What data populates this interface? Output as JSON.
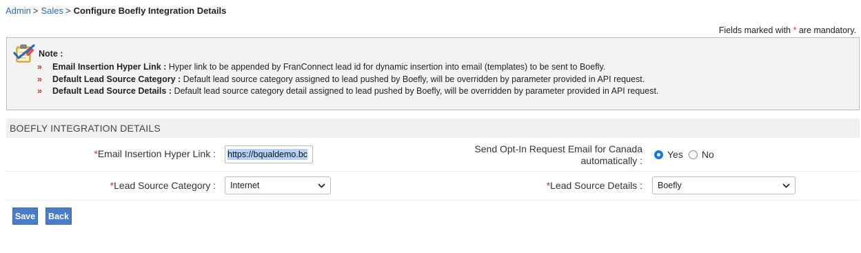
{
  "breadcrumb": {
    "items": [
      "Admin",
      "Sales"
    ],
    "separator": ">",
    "current": "Configure Boefly Integration Details"
  },
  "mandatory_note": {
    "prefix": "Fields marked with",
    "star": "*",
    "suffix": "are mandatory."
  },
  "note": {
    "title": "Note :",
    "bullet": "»",
    "items": [
      {
        "label": "Email Insertion Hyper Link :",
        "text": " Hyper link to be appended by FranConnect lead id for dynamic insertion into email (templates) to be sent to Boefly."
      },
      {
        "label": "Default Lead Source Category :",
        "text": " Default lead source category assigned to lead pushed by Boefly, will be overridden by parameter provided in API request."
      },
      {
        "label": "Default Lead Source Details :",
        "text": " Default lead source category detail assigned to lead pushed by Boefly, will be overridden by parameter provided in API request."
      }
    ]
  },
  "section": {
    "title": "BOEFLY INTEGRATION DETAILS"
  },
  "form": {
    "email_link": {
      "label": "Email Insertion Hyper Link :",
      "value": "https://bqualdemo.bc"
    },
    "opt_in": {
      "label_line1": "Send Opt-In Request Email for Canada",
      "label_line2": "automatically :",
      "options": [
        "Yes",
        "No"
      ],
      "selected": "Yes"
    },
    "lead_source_category": {
      "label": "Lead Source Category :",
      "value": "Internet"
    },
    "lead_source_details": {
      "label": "Lead Source Details :",
      "value": "Boefly"
    },
    "required_star": "*"
  },
  "buttons": {
    "save": "Save",
    "back": "Back"
  },
  "colors": {
    "link": "#2a6bb8",
    "required": "#e03030",
    "button": "#4a7dc9",
    "radio_accent": "#1a73e8"
  }
}
